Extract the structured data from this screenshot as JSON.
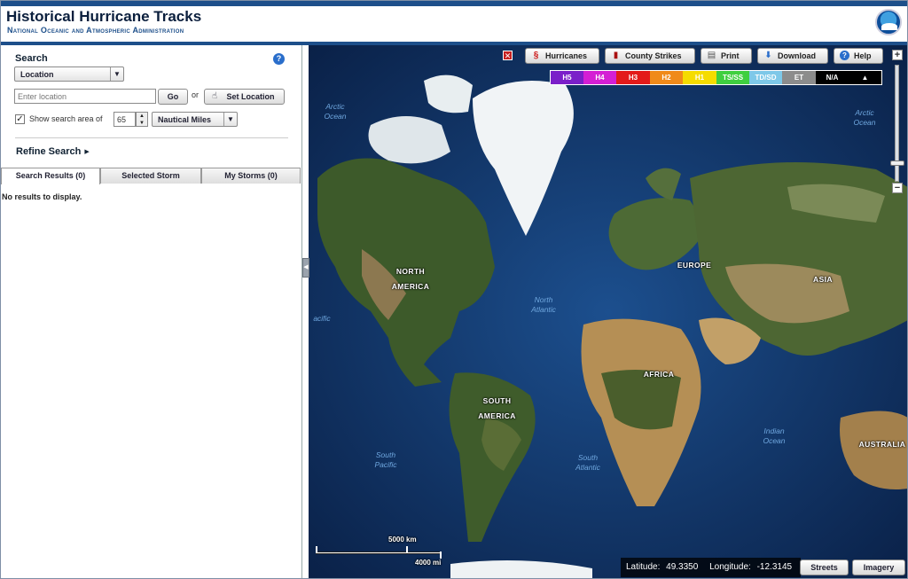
{
  "header": {
    "title": "Historical Hurricane Tracks",
    "subtitle": "National Oceanic and Atmospheric Administration",
    "logo_icon": "noaa-logo"
  },
  "search": {
    "title": "Search",
    "help_icon": "question-icon",
    "help_glyph": "?",
    "type_select": "Location",
    "location_placeholder": "Enter location",
    "go_label": "Go",
    "or_label": "or",
    "set_location_label": "Set Location",
    "show_area_label": "Show search area of",
    "show_area_checked": true,
    "area_value": "65",
    "unit_select": "Nautical Miles",
    "refine_label": "Refine Search"
  },
  "tabs": [
    {
      "label": "Search Results (0)",
      "active": true
    },
    {
      "label": "Selected Storm",
      "active": false
    },
    {
      "label": "My Storms (0)",
      "active": false
    }
  ],
  "results": {
    "empty_text": "No results to display."
  },
  "toolbar": {
    "close_icon": "close-icon",
    "buttons": [
      {
        "label": "Hurricanes",
        "icon": "hurricane-icon"
      },
      {
        "label": "County Strikes",
        "icon": "county-icon"
      },
      {
        "label": "Print",
        "icon": "printer-icon"
      },
      {
        "label": "Download",
        "icon": "download-icon"
      },
      {
        "label": "Help",
        "icon": "help-icon"
      }
    ]
  },
  "legend": [
    {
      "label": "H5",
      "color": "#7b1fc9"
    },
    {
      "label": "H4",
      "color": "#d41fd4"
    },
    {
      "label": "H3",
      "color": "#e31a1a"
    },
    {
      "label": "H2",
      "color": "#f08a1a"
    },
    {
      "label": "H1",
      "color": "#f5dc00"
    },
    {
      "label": "TS/SS",
      "color": "#3fcf3f"
    },
    {
      "label": "TD/SD",
      "color": "#7ec8e8"
    },
    {
      "label": "ET",
      "color": "#8c8c8c"
    },
    {
      "label": "N/A",
      "color": "#000000"
    },
    {
      "label": "▲",
      "color": "#000000"
    }
  ],
  "map": {
    "continents": [
      {
        "label": "NORTH\nAMERICA"
      },
      {
        "label": "EUROPE"
      },
      {
        "label": "ASIA"
      },
      {
        "label": "AFRICA"
      },
      {
        "label": "SOUTH\nAMERICA"
      },
      {
        "label": "AUSTRALIA"
      }
    ],
    "oceans": [
      {
        "label": "Arctic\nOcean"
      },
      {
        "label": "Arctic\nOcean"
      },
      {
        "label": "North\nAtlantic"
      },
      {
        "label": "acific"
      },
      {
        "label": "South\nPacific"
      },
      {
        "label": "South\nAtlantic"
      },
      {
        "label": "Indian\nOcean"
      }
    ],
    "zoom_in": "+",
    "zoom_out": "−",
    "scale_km": "5000 km",
    "scale_mi": "4000 mi",
    "latitude_label": "Latitude:",
    "latitude_value": "49.3350",
    "longitude_label": "Longitude:",
    "longitude_value": "-12.3145",
    "streets_label": "Streets",
    "imagery_label": "Imagery"
  }
}
